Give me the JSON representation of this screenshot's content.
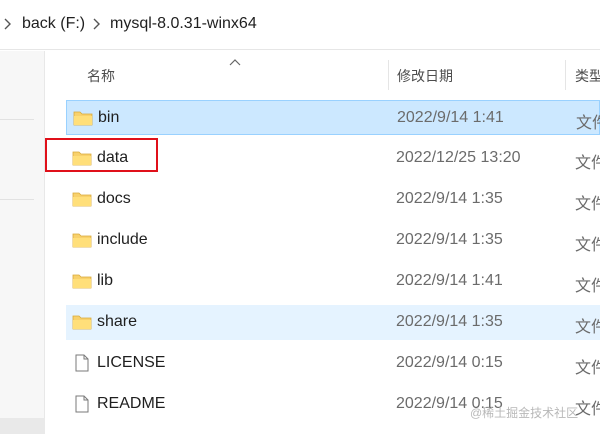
{
  "breadcrumb": {
    "items": [
      "back (F:)",
      "mysql-8.0.31-winx64"
    ]
  },
  "columns": {
    "name": "名称",
    "modified": "修改日期",
    "type": "类型"
  },
  "rows": [
    {
      "name": "bin",
      "modified": "2022/9/14 1:41",
      "type": "文件",
      "icon": "folder-icon",
      "state": "selected"
    },
    {
      "name": "data",
      "modified": "2022/12/25 13:20",
      "type": "文件",
      "icon": "folder-icon",
      "state": "normal",
      "annotated": true
    },
    {
      "name": "docs",
      "modified": "2022/9/14 1:35",
      "type": "文件",
      "icon": "folder-icon",
      "state": "normal"
    },
    {
      "name": "include",
      "modified": "2022/9/14 1:35",
      "type": "文件",
      "icon": "folder-icon",
      "state": "normal"
    },
    {
      "name": "lib",
      "modified": "2022/9/14 1:41",
      "type": "文件",
      "icon": "folder-icon",
      "state": "normal"
    },
    {
      "name": "share",
      "modified": "2022/9/14 1:35",
      "type": "文件",
      "icon": "folder-icon",
      "state": "hover"
    },
    {
      "name": "LICENSE",
      "modified": "2022/9/14 0:15",
      "type": "文件",
      "icon": "file-icon",
      "state": "normal"
    },
    {
      "name": "README",
      "modified": "2022/9/14 0:15",
      "type": "文件",
      "icon": "file-icon",
      "state": "normal"
    }
  ],
  "watermark": "@稀土掘金技术社区",
  "colors": {
    "selected_bg": "#cce8ff",
    "hover_bg": "#e5f3ff",
    "folder": "#f8d16c",
    "annotation": "#e0101a"
  }
}
